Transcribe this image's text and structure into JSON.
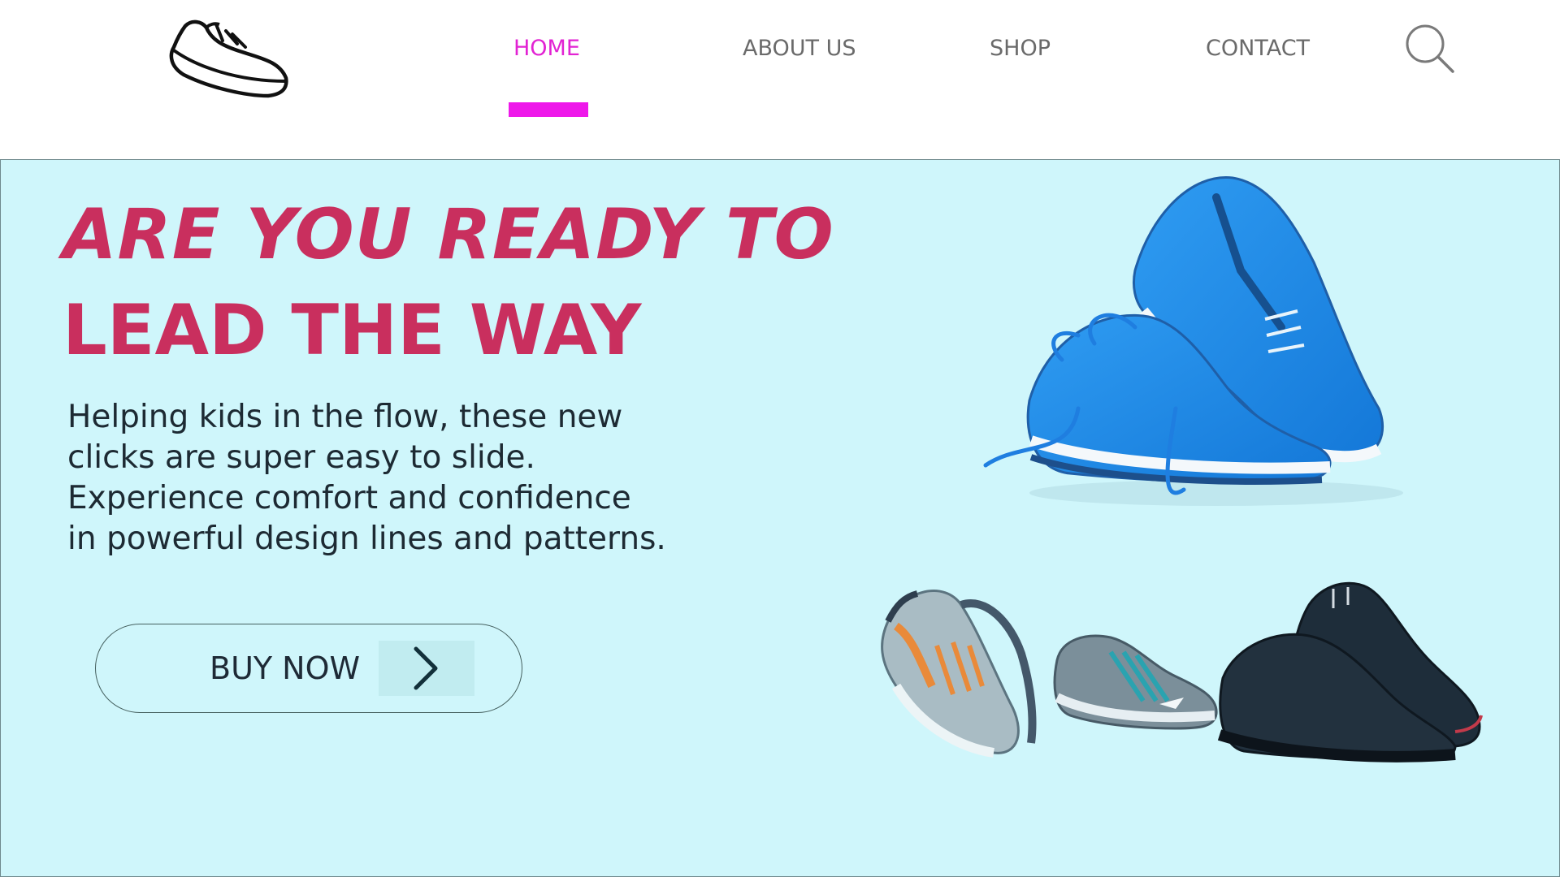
{
  "header": {
    "logo_icon": "sneaker-outline-icon",
    "nav": {
      "home": "HOME",
      "about": "ABOUT US",
      "shop": "SHOP",
      "contact": "CONTACT"
    },
    "search_icon": "search-icon",
    "active_item": "HOME"
  },
  "hero": {
    "headline_line1": "ARE YOU READY TO",
    "headline_line2": "LEAD THE WAY",
    "description_lines": [
      "Helping kids in the flow, these new",
      "clicks are super easy to slide.",
      "Experience comfort and confidence",
      "in powerful design lines and patterns."
    ],
    "cta_label": "BUY NOW",
    "cta_icon": "chevron-right-icon"
  },
  "colors": {
    "accent": "#e223d3",
    "underline": "#ee18ea",
    "headline": "#c92f5e",
    "hero_bg": "#cff6fb",
    "nav_text": "#6a6a6a"
  }
}
